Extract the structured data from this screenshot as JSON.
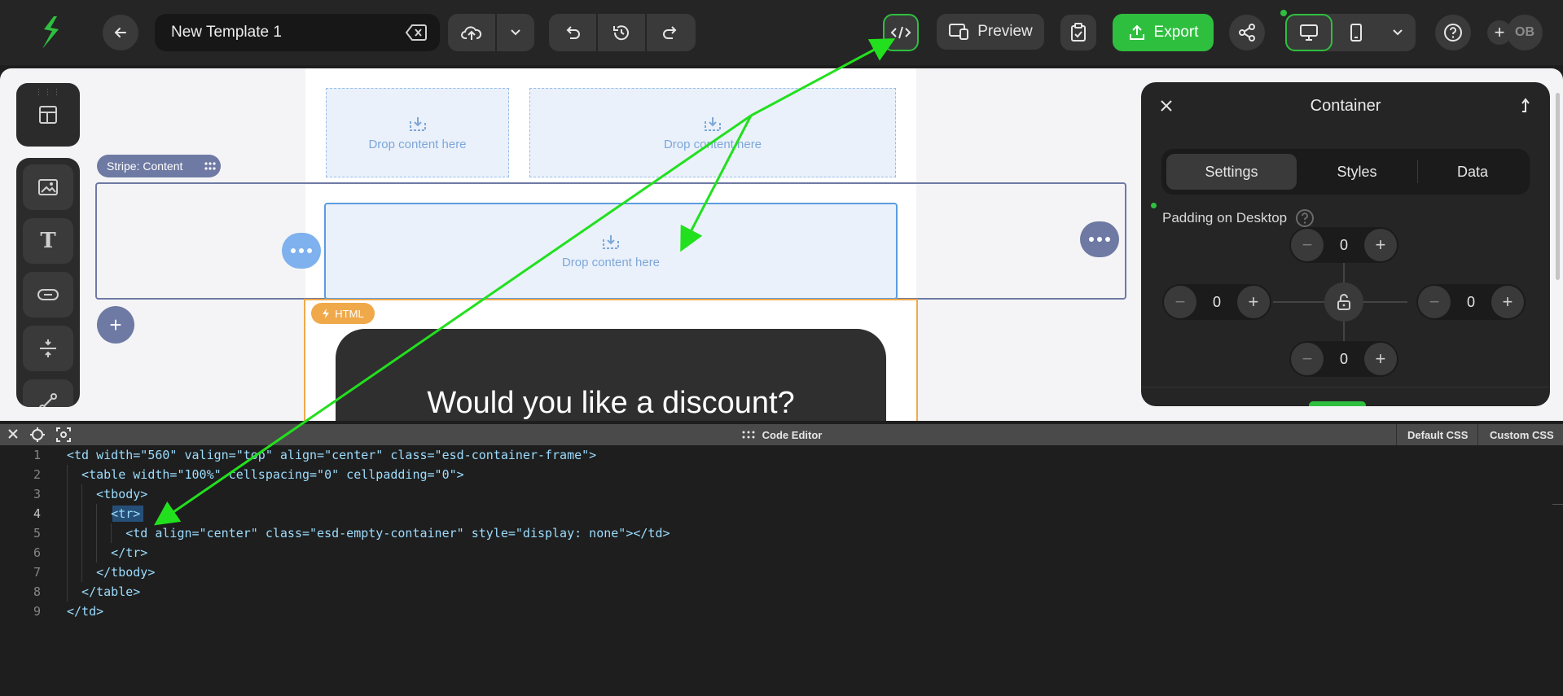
{
  "app": {
    "template_name": "New Template 1",
    "preview_label": "Preview",
    "export_label": "Export",
    "avatar_initials": "OB"
  },
  "canvas": {
    "drop_label": "Drop content here",
    "stripe_label": "Stripe: Content",
    "html_tag": "HTML",
    "discount_title": "Would you like a discount?"
  },
  "panel": {
    "title": "Container",
    "tabs": [
      "Settings",
      "Styles",
      "Data"
    ],
    "active_tab": "Settings",
    "padding_label": "Padding on Desktop",
    "padding": {
      "top": "0",
      "left": "0",
      "right": "0",
      "bottom": "0"
    }
  },
  "editor": {
    "title": "Code Editor",
    "default_css": "Default CSS",
    "custom_css": "Custom CSS",
    "line_numbers": [
      "1",
      "2",
      "3",
      "4",
      "5",
      "6",
      "7",
      "8",
      "9"
    ],
    "lines": [
      "<td width=\"560\" valign=\"top\" align=\"center\" class=\"esd-container-frame\">",
      "  <table width=\"100%\" cellspacing=\"0\" cellpadding=\"0\">",
      "    <tbody>",
      "      <tr>",
      "        <td align=\"center\" class=\"esd-empty-container\" style=\"display: none\"></td>",
      "      </tr>",
      "    </tbody>",
      "  </table>",
      "</td>"
    ]
  },
  "colors": {
    "accent": "#2fbf3f",
    "stripe": "#6e7aa3",
    "container_blue": "#5a9de0",
    "html_orange": "#f0a94a",
    "annotation_arrow": "#22e01e"
  }
}
